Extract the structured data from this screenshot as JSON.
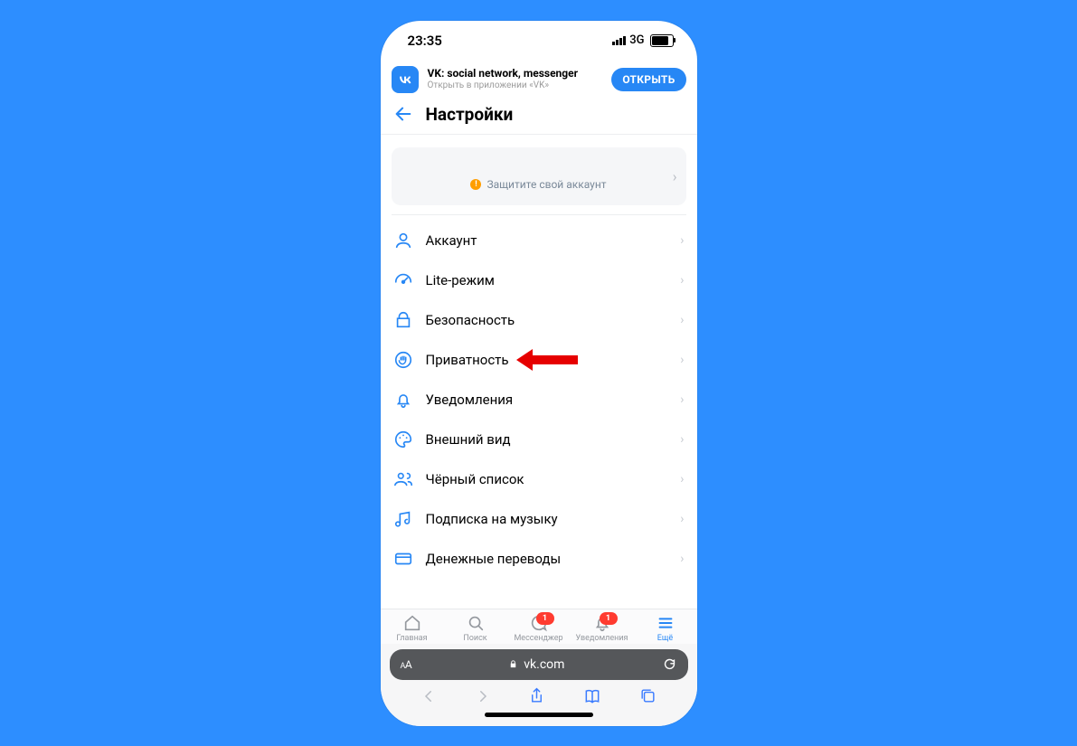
{
  "status": {
    "time": "23:35",
    "net": "3G"
  },
  "banner": {
    "logo_text": "VK",
    "title": "VK: social network, messenger",
    "subtitle": "Открыть в приложении «VK»",
    "button": "ОТКРЫТЬ"
  },
  "header": {
    "title": "Настройки"
  },
  "protect": {
    "text": "Защитите свой аккаунт",
    "warn": "!"
  },
  "menu": [
    {
      "label": "Аккаунт"
    },
    {
      "label": "Lite-режим"
    },
    {
      "label": "Безопасность"
    },
    {
      "label": "Приватность"
    },
    {
      "label": "Уведомления"
    },
    {
      "label": "Внешний вид"
    },
    {
      "label": "Чёрный список"
    },
    {
      "label": "Подписка на музыку"
    },
    {
      "label": "Денежные переводы"
    }
  ],
  "tabs": {
    "home": "Главная",
    "search": "Поиск",
    "messenger": "Мессенджер",
    "notifications": "Уведомления",
    "more": "Ещё",
    "badge_msg": "1",
    "badge_notif": "1"
  },
  "safari": {
    "aa_small": "A",
    "aa_big": "A",
    "host": "vk.com"
  },
  "callout_target_index": 3
}
